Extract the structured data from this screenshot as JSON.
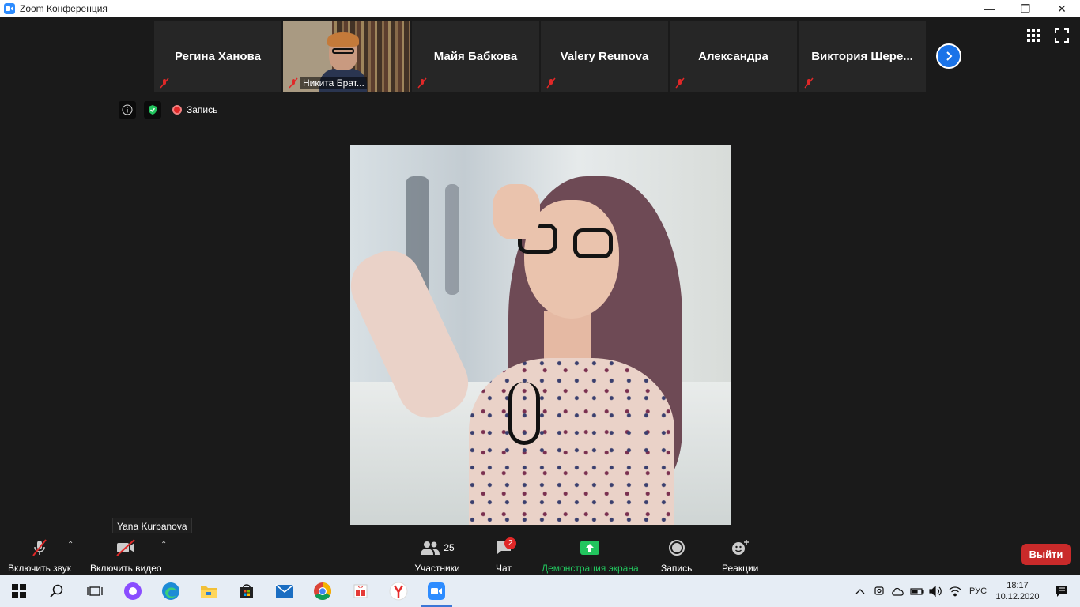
{
  "window": {
    "title": "Zoom Конференция",
    "minimize": "—",
    "restore": "❐",
    "close": "✕"
  },
  "participants_strip": {
    "tiles": [
      {
        "name": "Регина Ханова",
        "muted": true
      },
      {
        "name": "Никита Брат...",
        "muted": true,
        "video": true
      },
      {
        "name": "Майя Бабкова",
        "muted": true
      },
      {
        "name": "Valery Reunova",
        "muted": true
      },
      {
        "name": "Александра",
        "muted": true
      },
      {
        "name": "Виктория  Шере...",
        "muted": true
      }
    ]
  },
  "info_bar": {
    "recording_label": "Запись"
  },
  "tooltip": {
    "text": "Yana Kurbanova"
  },
  "toolbar": {
    "audio_label": "Включить звук",
    "video_label": "Включить видео",
    "participants_label": "Участники",
    "participants_count": "25",
    "chat_label": "Чат",
    "chat_badge": "2",
    "share_label": "Демонстрация экрана",
    "record_label": "Запись",
    "reactions_label": "Реакции",
    "leave_label": "Выйти"
  },
  "taskbar": {
    "lang": "РУС",
    "time": "18:17",
    "date": "10.12.2020"
  },
  "colors": {
    "accent": "#2d8cff",
    "share_green": "#22c55e",
    "leave_red": "#c92a2a",
    "badge_red": "#e02828"
  }
}
